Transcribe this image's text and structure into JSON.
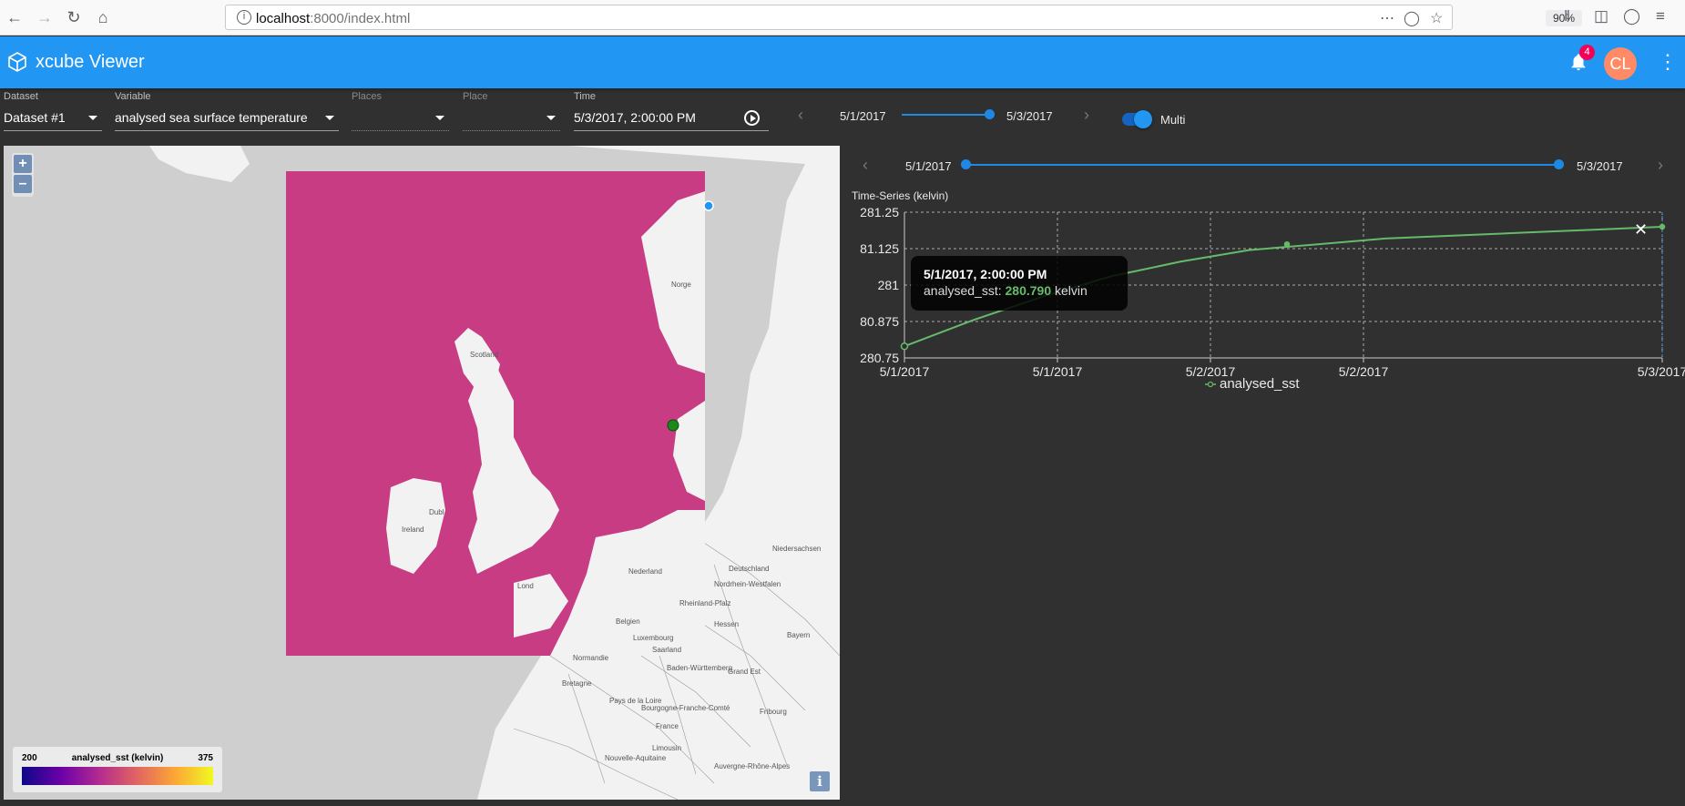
{
  "browser": {
    "url_host": "localhost",
    "url_path": ":8000/index.html",
    "zoom": "90%"
  },
  "app": {
    "title": "xcube Viewer",
    "notification_count": "4",
    "avatar_initials": "CL"
  },
  "controls": {
    "dataset": {
      "label": "Dataset",
      "value": "Dataset #1"
    },
    "variable": {
      "label": "Variable",
      "value": "analysed sea surface temperature"
    },
    "places": {
      "label": "Places",
      "value": ""
    },
    "place": {
      "label": "Place",
      "value": ""
    },
    "time": {
      "label": "Time",
      "value": "5/3/2017, 2:00:00 PM"
    }
  },
  "time_slider": {
    "start": "5/1/2017",
    "end": "5/3/2017",
    "multi_label": "Multi"
  },
  "range_slider": {
    "start": "5/1/2017",
    "end": "5/3/2017"
  },
  "map": {
    "labels": [
      "Norge",
      "Scotland",
      "Ireland",
      "Dubl",
      "Lond",
      "Nederland",
      "Belgien",
      "Luxembourg",
      "Saarland",
      "Baden-Württemberg",
      "Deutschland",
      "Rheinland-Pfalz",
      "Normandie",
      "Bretagne",
      "Pays de la Loire",
      "Grand Est",
      "France",
      "Bourgogne-Franche-Comté",
      "Fribourg",
      "Limousin",
      "Nouvelle-Aquitaine",
      "Auvergne-Rhône-Alpes",
      "Niedersachsen",
      "Nordrhein-Westfalen",
      "Hessen",
      "Bayern"
    ],
    "legend": {
      "min": "200",
      "title": "analysed_sst (kelvin)",
      "max": "375"
    },
    "colors": {
      "overlay": "#c83c84",
      "land": "#f2f2f2",
      "sea": "#cccccc"
    }
  },
  "chart_title": "Time-Series (kelvin)",
  "tooltip": {
    "time": "5/1/2017, 2:00:00 PM",
    "var": "analysed_sst:",
    "value": "280.790",
    "unit": "kelvin"
  },
  "chart_data": {
    "type": "line",
    "title": "Time-Series (kelvin)",
    "xlabel": "",
    "ylabel": "",
    "y_ticks": [
      "281.25",
      "81.125",
      "281",
      "80.875",
      "280.75"
    ],
    "x_ticks": [
      "5/1/2017",
      "5/1/2017",
      "5/2/2017",
      "5/2/2017",
      "5/3/2017"
    ],
    "ylim": [
      280.75,
      281.25
    ],
    "grid": true,
    "legend": "bottom-center",
    "series": [
      {
        "name": "analysed_sst",
        "color": "#66bb6a",
        "x": [
          "5/1/2017",
          "5/2/2017",
          "5/3/2017"
        ],
        "y": [
          280.79,
          281.14,
          281.2
        ],
        "curve": [
          280.79,
          280.88,
          280.96,
          281.03,
          281.08,
          281.12,
          281.14,
          281.16,
          281.17,
          281.18,
          281.19,
          281.2
        ]
      }
    ]
  }
}
